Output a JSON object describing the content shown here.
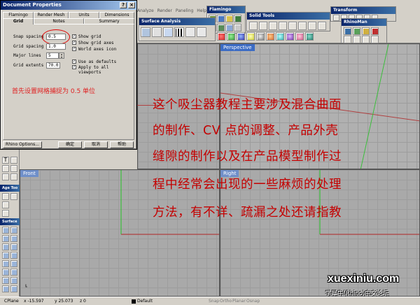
{
  "menu": [
    "Analyze",
    "Render",
    "Paneling",
    "Help"
  ],
  "dialog": {
    "title": "Document Properties",
    "tabs_row1": [
      "Flamingo",
      "Render Mesh",
      "Units",
      "Dimensions"
    ],
    "tabs_row2": [
      "Grid",
      "Notes",
      "Summary"
    ],
    "fields": [
      {
        "label": "Snap spacing",
        "value": "0.5"
      },
      {
        "label": "Grid spacing",
        "value": "1.0"
      },
      {
        "label": "Major lines",
        "value": "5"
      },
      {
        "label": "Grid extents",
        "value": "70.0"
      }
    ],
    "checks": [
      {
        "label": "Show grid",
        "checked": "✓"
      },
      {
        "label": "Show grid axes",
        "checked": "✓"
      },
      {
        "label": "World axes icon",
        "checked": "✓"
      },
      {
        "label": "Use as defaults",
        "checked": "✓"
      },
      {
        "label": "Apply to all viewports",
        "checked": "✓"
      }
    ],
    "note": "首先设置网格捕捉为 0.5 单位",
    "buttons": {
      "options": "Rhino Options...",
      "ok": "确定",
      "cancel": "取消",
      "help": "帮助"
    }
  },
  "toolbars": {
    "flamingo": "Flamingo",
    "surface_analysis": "Surface Analysis",
    "solid_tools": "Solid Tools",
    "transform": "Transform",
    "rhinoman": "RhinoMan",
    "age_tools": "Age Too",
    "surface": "Surface"
  },
  "viewports": {
    "perspective": "Perspective",
    "front": "Front",
    "right": "Right"
  },
  "tutorial_text": [
    "这个吸尘器教程主要涉及混合曲面",
    "的制作、CV 点的调整、产品外壳",
    "缝隙的制作以及在产品模型制作过",
    "程中经常会出现的一些麻烦的处理",
    "方法，有不详、疏漏之处还请指教"
  ],
  "watermark": {
    "site": "xuexiniu.com",
    "forum": "学犀牛(Rhino)中文论坛"
  },
  "statusbar": {
    "cplane": "CPlane",
    "x": "x -15.597",
    "y": "y 25.073",
    "z": "z 0",
    "layer": "Default",
    "toggles": [
      "Snap",
      "Ortho",
      "Planar",
      "Osnap"
    ]
  },
  "colors": {
    "text_red": "#c40000",
    "title_blue": "#0a246a",
    "active_vp": "#3c6cc4"
  }
}
